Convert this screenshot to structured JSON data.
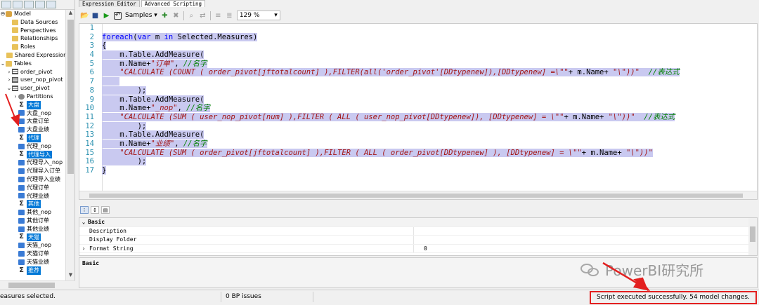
{
  "tabs": [
    "Expression Editor",
    "Advanced Scripting"
  ],
  "toolbar": {
    "samples_label": "Samples",
    "zoom": "129 %"
  },
  "tree": [
    {
      "label": "Model",
      "icon": "db",
      "indent": 0,
      "exp": "⊖"
    },
    {
      "label": "Data Sources",
      "icon": "folder",
      "indent": 1
    },
    {
      "label": "Perspectives",
      "icon": "folder",
      "indent": 1
    },
    {
      "label": "Relationships",
      "icon": "folder",
      "indent": 1
    },
    {
      "label": "Roles",
      "icon": "folder",
      "indent": 1
    },
    {
      "label": "Shared Expressions",
      "icon": "folder",
      "indent": 1
    },
    {
      "label": "Tables",
      "icon": "folder",
      "indent": 0,
      "exp": "⌄"
    },
    {
      "label": "order_pivot",
      "icon": "table",
      "indent": 1,
      "exp": "›"
    },
    {
      "label": "user_nop_pivot",
      "icon": "table",
      "indent": 1,
      "exp": "›"
    },
    {
      "label": "user_pivot",
      "icon": "table",
      "indent": 1,
      "exp": "⌄"
    },
    {
      "label": "Partitions",
      "icon": "part",
      "indent": 2,
      "exp": "›"
    },
    {
      "label": "大盘",
      "icon": "sigma",
      "indent": 2,
      "sel": true
    },
    {
      "label": "大盘_nop",
      "icon": "meas",
      "indent": 2
    },
    {
      "label": "大盘订单",
      "icon": "meas",
      "indent": 2
    },
    {
      "label": "大盘业绩",
      "icon": "meas",
      "indent": 2
    },
    {
      "label": "代理",
      "icon": "sigma",
      "indent": 2,
      "sel": true
    },
    {
      "label": "代理_nop",
      "icon": "meas",
      "indent": 2
    },
    {
      "label": "代理导入",
      "icon": "sigma",
      "indent": 2,
      "sel": true
    },
    {
      "label": "代理导入_nop",
      "icon": "meas",
      "indent": 2
    },
    {
      "label": "代理导入订单",
      "icon": "meas",
      "indent": 2
    },
    {
      "label": "代理导入业绩",
      "icon": "meas",
      "indent": 2
    },
    {
      "label": "代理订单",
      "icon": "meas",
      "indent": 2
    },
    {
      "label": "代理业绩",
      "icon": "meas",
      "indent": 2
    },
    {
      "label": "其他",
      "icon": "sigma",
      "indent": 2,
      "sel": true
    },
    {
      "label": "其他_nop",
      "icon": "meas",
      "indent": 2
    },
    {
      "label": "其他订单",
      "icon": "meas",
      "indent": 2
    },
    {
      "label": "其他业绩",
      "icon": "meas",
      "indent": 2
    },
    {
      "label": "天猫",
      "icon": "sigma",
      "indent": 2,
      "sel": true
    },
    {
      "label": "天猫_nop",
      "icon": "meas",
      "indent": 2
    },
    {
      "label": "天猫订单",
      "icon": "meas",
      "indent": 2
    },
    {
      "label": "天猫业绩",
      "icon": "meas",
      "indent": 2
    },
    {
      "label": "推荐",
      "icon": "sigma",
      "indent": 2,
      "sel": true
    }
  ],
  "code": [
    "",
    "foreach(var m in Selected.Measures)",
    "{",
    "    m.Table.AddMeasure(",
    "    m.Name+\"订单\", //名字",
    "    \"CALCULATE (COUNT ( order_pivot[jftotalcount] ),FILTER(all('order_pivot'[DDtypenew]),[DDtypenew] =\\\"\"+ m.Name+ \"\\\"))\"  //表达式",
    "    ",
    "        );",
    "    m.Table.AddMeasure(",
    "    m.Name+\"_nop\", //名字",
    "    \"CALCULATE (SUM ( user_nop_pivot[num] ),FILTER ( ALL ( user_nop_pivot[DDtypenew]), [DDtypenew] = \\\"\"+ m.Name+ \"\\\"))\"  //表达式",
    "        );",
    "    m.Table.AddMeasure(",
    "    m.Name+\"业绩\", //名字",
    "    \"CALCULATE (SUM ( order_pivot[jftotalcount] ),FILTER ( ALL ( order_pivot[DDtypenew] ), [DDtypenew] = \\\"\"+ m.Name+ \"\\\"))\"",
    "        );",
    "}"
  ],
  "properties": {
    "category": "Basic",
    "rows": [
      {
        "name": "Description",
        "value": ""
      },
      {
        "name": "Display Folder",
        "value": ""
      },
      {
        "name": "Format String",
        "value": "0",
        "exp": "›"
      }
    ],
    "description_title": "Basic"
  },
  "status": {
    "left": "easures selected.",
    "middle": "0 BP issues",
    "right": "Script executed successfully. 54 model changes."
  },
  "watermark": "PowerBI研究所",
  "colors": {
    "highlight": "#c9c9f0",
    "selection": "#0078d7",
    "annotation": "#e32020"
  }
}
